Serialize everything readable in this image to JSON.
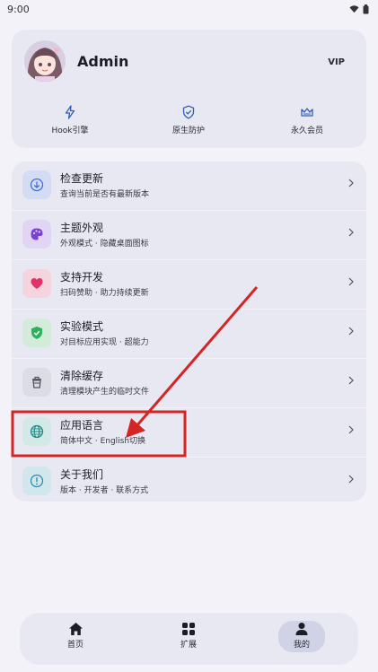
{
  "status": {
    "time": "9:00"
  },
  "profile": {
    "username": "Admin",
    "badge": "VIP",
    "features": [
      {
        "icon": "lightning-icon",
        "label": "Hook引擎"
      },
      {
        "icon": "shield-icon",
        "label": "原生防护"
      },
      {
        "icon": "crown-icon",
        "label": "永久会员"
      }
    ]
  },
  "menu": {
    "items": [
      {
        "icon": "download-icon",
        "title": "检查更新",
        "subtitle": "查询当前是否有最新版本",
        "accent": "#3d6fe0"
      },
      {
        "icon": "palette-icon",
        "title": "主题外观",
        "subtitle": "外观模式 · 隐藏桌面图标",
        "accent": "#7b3fd6"
      },
      {
        "icon": "heart-icon",
        "title": "支持开发",
        "subtitle": "扫码赞助 · 助力持续更新",
        "accent": "#e0336e"
      },
      {
        "icon": "shield-check-icon",
        "title": "实验模式",
        "subtitle": "对目标应用实现 · 超能力",
        "accent": "#2db05a"
      },
      {
        "icon": "trash-icon",
        "title": "清除缓存",
        "subtitle": "清理模块产生的临时文件",
        "accent": "#555566"
      },
      {
        "icon": "globe-icon",
        "title": "应用语言",
        "subtitle": "简体中文 · English切换",
        "accent": "#1f8a86"
      },
      {
        "icon": "info-icon",
        "title": "关于我们",
        "subtitle": "版本 · 开发者 · 联系方式",
        "accent": "#2a8fa8"
      }
    ]
  },
  "nav": {
    "items": [
      {
        "icon": "home-icon",
        "label": "首页"
      },
      {
        "icon": "grid-icon",
        "label": "扩展"
      },
      {
        "icon": "person-icon",
        "label": "我的"
      }
    ]
  },
  "annotation": {
    "color": "#d42424"
  }
}
